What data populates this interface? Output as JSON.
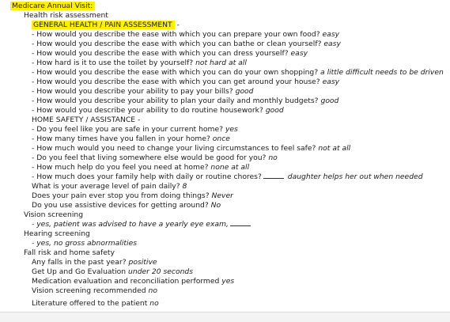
{
  "title": "Medicare Annual Visit:",
  "hra_heading": "Health risk assessment",
  "general_heading": "GENERAL HEALTH / PAIN ASSESSMENT",
  "general_dash": "-",
  "general_items": [
    {
      "q": "- How would you describe the ease with which you can prepare your own food?",
      "a": "easy"
    },
    {
      "q": "- How would you describe the ease with which you can bathe or clean yourself?",
      "a": "easy"
    },
    {
      "q": "- How would you describe the ease with which you can dress yourself?",
      "a": "easy"
    },
    {
      "q": "- How hard is it to use the toilet by yourself?",
      "a": "not hard at all"
    },
    {
      "q": "- How would you describe the ease with which you can do your own shopping?",
      "a": "a little difficult needs to be driven"
    },
    {
      "q": "- How would you describe the ease with which you can get around your house?",
      "a": "easy"
    },
    {
      "q": "- How would you describe your ability to pay your bills?",
      "a": "good"
    },
    {
      "q": "- How would you describe your ability to plan your daily and monthly budgets?",
      "a": "good"
    },
    {
      "q": "- How would you describe your ability to do routine housework?",
      "a": "good"
    }
  ],
  "home_safety_heading": "HOME SAFETY / ASSISTANCE  -",
  "home_items": [
    {
      "q": "- Do you feel like you are safe in your current home?",
      "a": "yes"
    },
    {
      "q": "- How many times have you fallen in your home?",
      "a": "once"
    },
    {
      "q": "- How much would you need to change your living circumstances to feel safe?",
      "a": "not at all"
    },
    {
      "q": "- Do you feel that living somewhere else would be good for you?",
      "a": "no"
    },
    {
      "q": "- How much help do you feel you need at home?",
      "a": "none at all"
    }
  ],
  "family_help": {
    "q": "- How much does your family help with daily or routine chores?",
    "a": "daughter helps her out when needed"
  },
  "pain_items": [
    {
      "q": "What is your average level of pain daily?",
      "a": "8"
    },
    {
      "q": "Does your pain ever stop you from doing things?",
      "a": "Never"
    },
    {
      "q": "Do you use assistive devices for getting around?",
      "a": "No"
    }
  ],
  "vision_heading": "Vision screening",
  "vision_answer": "- yes, patient was advised to have a yearly eye exam,",
  "hearing_heading": "Hearing screening",
  "hearing_answer": "- yes, no gross abnormalities",
  "fall_heading": "Fall risk and home safety",
  "fall_items": [
    {
      "q": "Any falls in the past year?",
      "a": "positive"
    },
    {
      "q": "Get Up and Go Evaluation",
      "a": "under 20 seconds"
    },
    {
      "q": "Medication evaluation and reconciliation performed",
      "a": "yes"
    },
    {
      "q": "Vision screening recommended",
      "a": "no"
    },
    {
      "q": "Literature offered to the patient",
      "a": "no"
    }
  ]
}
